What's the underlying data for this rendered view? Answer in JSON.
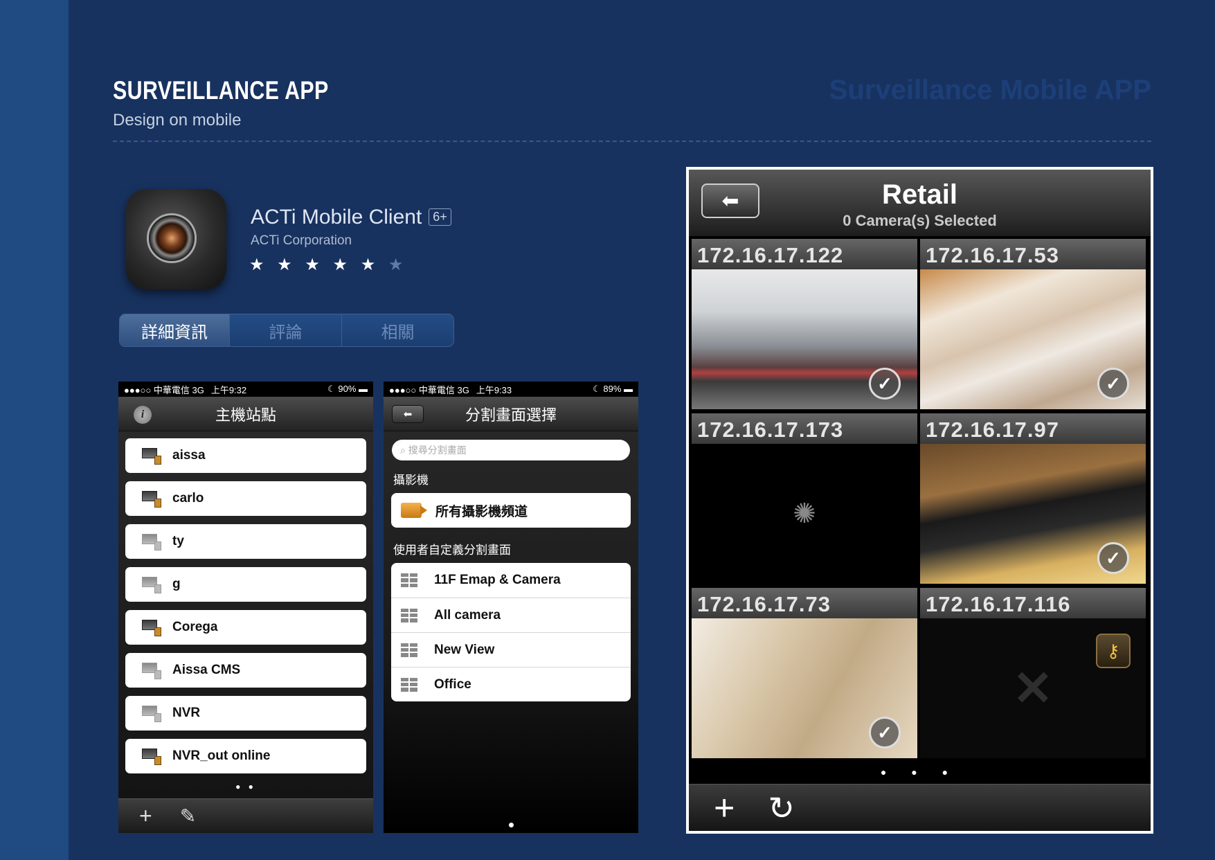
{
  "page": {
    "title": "SURVEILLANCE APP",
    "subtitle": "Design on mobile",
    "watermark": "Surveillance Mobile APP"
  },
  "app": {
    "name": "ACTi Mobile Client",
    "age": "6+",
    "company": "ACTi Corporation",
    "rating": 5,
    "rating_max": 6,
    "star_on": "★ ★ ★ ★ ★",
    "star_off": "★",
    "tabs": [
      "詳細資訊",
      "評論",
      "相關"
    ]
  },
  "phone1": {
    "status": {
      "carrier": "●●●○○ 中華電信  3G",
      "time": "上午9:32",
      "battery": "☾ 90% ▬"
    },
    "title": "主機站點",
    "hosts": [
      "aissa",
      "carlo",
      "ty",
      "g",
      "Corega",
      "Aissa CMS",
      "NVR",
      "NVR_out online"
    ],
    "page_dots": "● ●"
  },
  "phone2": {
    "status": {
      "carrier": "●●●○○ 中華電信  3G",
      "time": "上午9:33",
      "battery": "☾ 89% ▬"
    },
    "title": "分割畫面選擇",
    "search_placeholder": "搜尋分割畫面",
    "section_camera": "攝影機",
    "all_cameras": "所有攝影機頻道",
    "section_custom": "使用者自定義分割畫面",
    "views": [
      "11F Emap & Camera",
      "All camera",
      "New View",
      "Office"
    ]
  },
  "big": {
    "title": "Retail",
    "subtitle": "0 Camera(s) Selected",
    "cameras": [
      "172.16.17.122",
      "172.16.17.53",
      "172.16.17.173",
      "172.16.17.97",
      "172.16.17.73",
      "172.16.17.116"
    ],
    "page_dots": "● ● ●"
  },
  "colors": {
    "background": "#18325f",
    "band": "#1f4a82",
    "watermark": "#1d3f79"
  }
}
